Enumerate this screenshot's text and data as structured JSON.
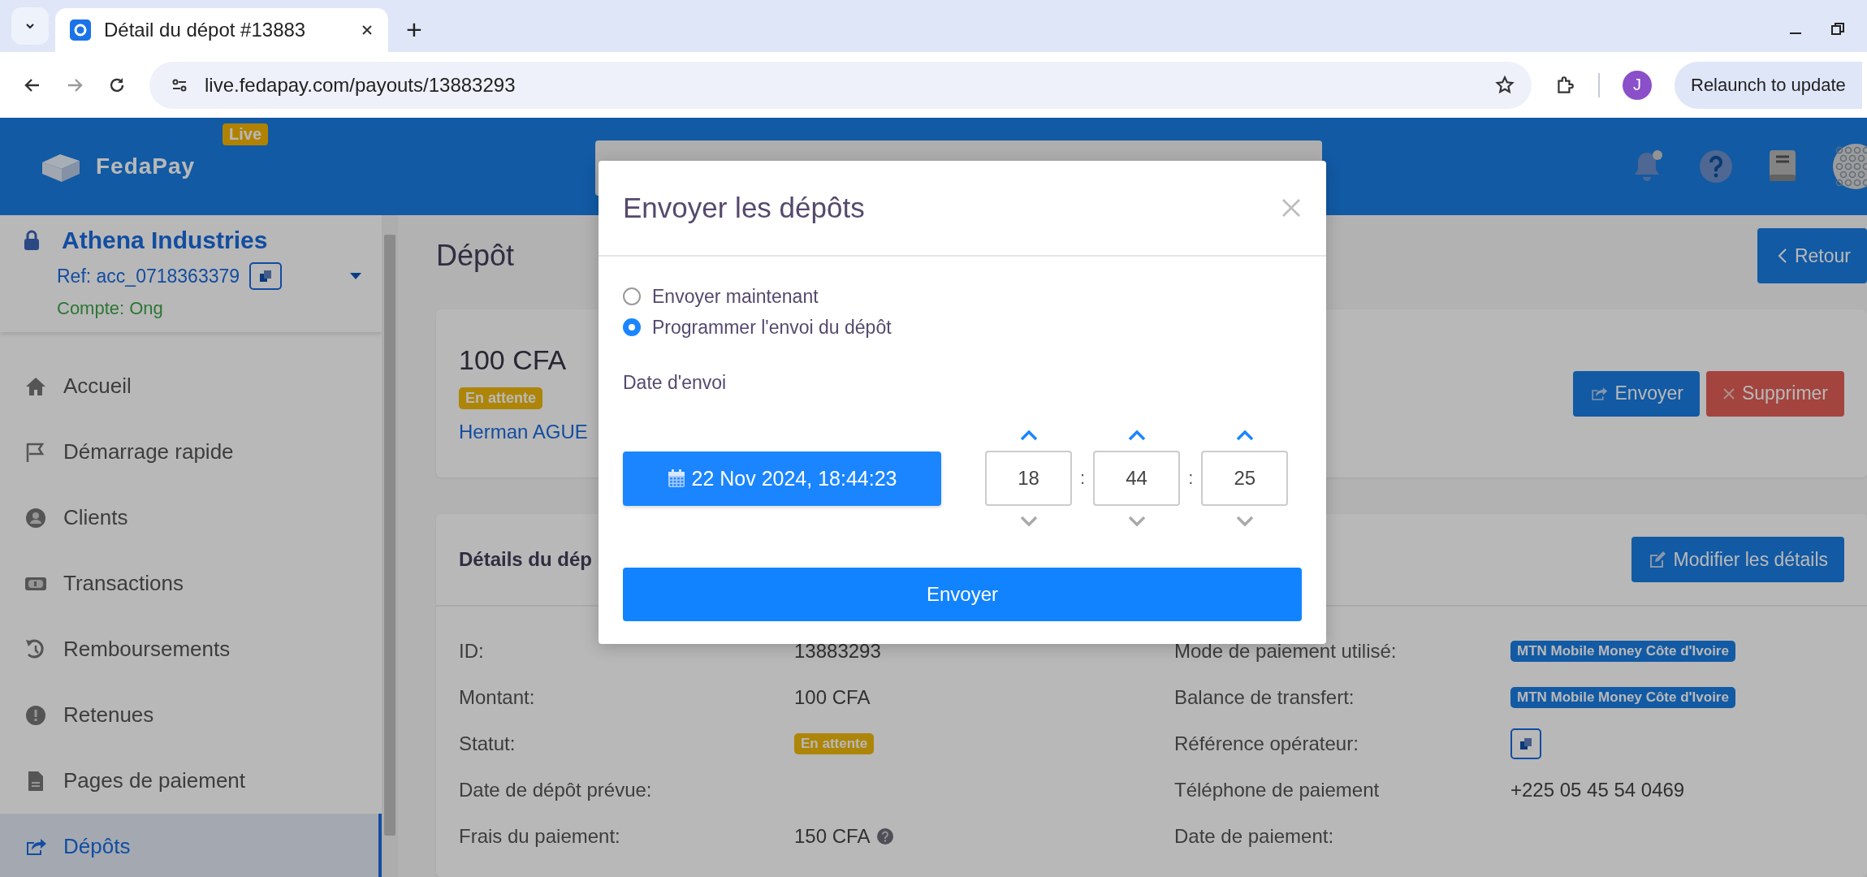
{
  "browser": {
    "tab": {
      "title": "Détail du dépot #13883"
    },
    "new_tab": "+",
    "url": "live.fedapay.com/payouts/13883293",
    "profile": "J",
    "relaunch": "Relaunch to update"
  },
  "header": {
    "brand": "FedaPay",
    "env_badge": "Live"
  },
  "account": {
    "name": "Athena Industries",
    "ref": "Ref: acc_0718363379",
    "type": "Compte: Ong"
  },
  "sidebar": {
    "items": [
      {
        "label": "Accueil",
        "selected": false
      },
      {
        "label": "Démarrage rapide",
        "selected": false
      },
      {
        "label": "Clients",
        "selected": false
      },
      {
        "label": "Transactions",
        "selected": false
      },
      {
        "label": "Remboursements",
        "selected": false
      },
      {
        "label": "Retenues",
        "selected": false
      },
      {
        "label": "Pages de paiement",
        "selected": false
      },
      {
        "label": "Dépôts",
        "selected": true
      }
    ]
  },
  "page": {
    "title": "Dépôt",
    "back_button": "Retour"
  },
  "summary": {
    "amount": "100 CFA",
    "status": "En attente",
    "customer": "Herman AGUE",
    "actions": [
      {
        "label": "Envoyer",
        "kind": "primary"
      },
      {
        "label": "Supprimer",
        "kind": "danger"
      }
    ]
  },
  "details": {
    "title": "Détails du dép",
    "edit_button": "Modifier les détails",
    "left": [
      {
        "label": "ID:",
        "kind": "text",
        "value": "13883293"
      },
      {
        "label": "Montant:",
        "kind": "text",
        "value": "100 CFA"
      },
      {
        "label": "Statut:",
        "kind": "status",
        "value": "En attente"
      },
      {
        "label": "Date de dépôt prévue:",
        "kind": "empty"
      },
      {
        "label": "Frais du paiement:",
        "kind": "help",
        "value": "150 CFA"
      }
    ],
    "right": [
      {
        "label": "Mode de paiement utilisé:",
        "kind": "badge",
        "value": "MTN Mobile Money Côte d'Ivoire"
      },
      {
        "label": "Balance de transfert:",
        "kind": "badge",
        "value": "MTN Mobile Money Côte d'Ivoire"
      },
      {
        "label": "Référence opérateur:",
        "kind": "copy"
      },
      {
        "label": "Téléphone de paiement",
        "kind": "text",
        "value": "+225 05 45 54 0469"
      },
      {
        "label": "Date de paiement:",
        "kind": "empty"
      }
    ]
  },
  "modal": {
    "title": "Envoyer les dépôts",
    "options": [
      {
        "label": "Envoyer maintenant",
        "selected": false
      },
      {
        "label": "Programmer l'envoi du dépôt",
        "selected": true
      }
    ],
    "date_label": "Date d'envoi",
    "date_button": "22 Nov 2024, 18:44:23",
    "time": [
      {
        "value": "18"
      },
      {
        "separator": ":",
        "value": "44"
      },
      {
        "separator": ":",
        "value": "25"
      }
    ],
    "submit": "Envoyer"
  }
}
